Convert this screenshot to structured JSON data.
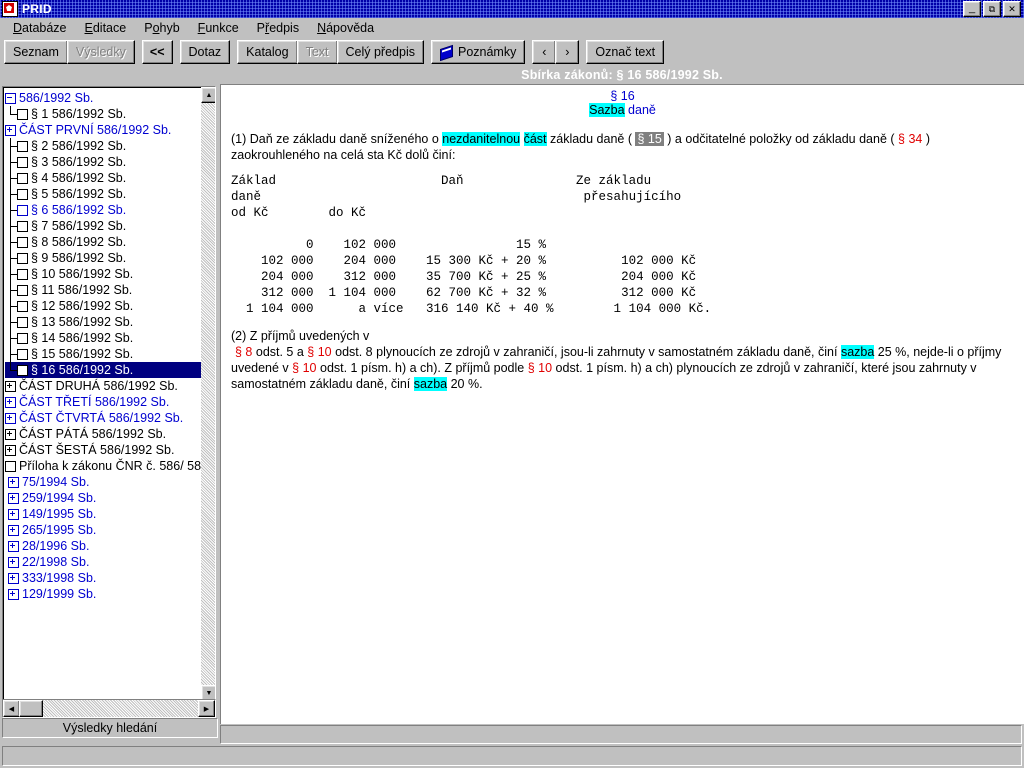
{
  "window": {
    "title": "PRID",
    "icon": "app-icon",
    "buttons": {
      "minimize": "_",
      "maximize": "❐",
      "close": "✕"
    }
  },
  "menu": [
    {
      "pre": "",
      "accel": "D",
      "post": "atabáze"
    },
    {
      "pre": "",
      "accel": "E",
      "post": "ditace"
    },
    {
      "pre": "P",
      "accel": "o",
      "post": "hyb"
    },
    {
      "pre": "",
      "accel": "F",
      "post": "unkce"
    },
    {
      "pre": "P",
      "accel": "ř",
      "post": "edpis"
    },
    {
      "pre": "",
      "accel": "N",
      "post": "ápověda"
    }
  ],
  "toolbar": {
    "groups": [
      {
        "buttons": [
          {
            "label": "Seznam",
            "disabled": false,
            "icon": null
          },
          {
            "label": "Výsledky",
            "disabled": true,
            "icon": null
          }
        ]
      },
      {
        "buttons": [
          {
            "label": "<<",
            "disabled": false,
            "icon": null
          }
        ]
      },
      {
        "buttons": [
          {
            "label": "Dotaz",
            "disabled": false,
            "icon": null
          }
        ]
      },
      {
        "buttons": [
          {
            "label": "Katalog",
            "disabled": false,
            "icon": null
          },
          {
            "label": "Text",
            "disabled": true,
            "icon": null
          },
          {
            "label": "Celý předpis",
            "disabled": false,
            "icon": null
          }
        ]
      },
      {
        "buttons": [
          {
            "label": "Poznámky",
            "disabled": false,
            "icon": "notebook-icon"
          }
        ]
      },
      {
        "buttons": [
          {
            "label": "‹",
            "disabled": false,
            "icon": null
          },
          {
            "label": "›",
            "disabled": false,
            "icon": null
          }
        ]
      },
      {
        "buttons": [
          {
            "label": "Označ text",
            "disabled": false,
            "icon": null
          }
        ]
      }
    ]
  },
  "header": {
    "caption": "Sbírka zákonů:   § 16 586/1992 Sb."
  },
  "tree": {
    "items": [
      {
        "depth": 0,
        "box": "minus",
        "boxColor": "blue",
        "label": "586/1992 Sb.",
        "color": "blue",
        "selected": false,
        "last": false
      },
      {
        "depth": 1,
        "box": "none",
        "boxColor": "black",
        "label": "§ 1 586/1992 Sb.",
        "color": "black",
        "selected": false,
        "last": true
      },
      {
        "depth": 0,
        "box": "plus",
        "boxColor": "blue",
        "label": "ČÁST PRVNÍ 586/1992 Sb.",
        "color": "blue",
        "selected": false,
        "last": false
      },
      {
        "depth": 1,
        "box": "none",
        "boxColor": "black",
        "label": "§ 2 586/1992 Sb.",
        "color": "black",
        "selected": false,
        "last": false
      },
      {
        "depth": 1,
        "box": "none",
        "boxColor": "black",
        "label": "§ 3 586/1992 Sb.",
        "color": "black",
        "selected": false,
        "last": false
      },
      {
        "depth": 1,
        "box": "none",
        "boxColor": "black",
        "label": "§ 4 586/1992 Sb.",
        "color": "black",
        "selected": false,
        "last": false
      },
      {
        "depth": 1,
        "box": "none",
        "boxColor": "black",
        "label": "§ 5 586/1992 Sb.",
        "color": "black",
        "selected": false,
        "last": false
      },
      {
        "depth": 1,
        "box": "none",
        "boxColor": "blue",
        "label": "§ 6 586/1992 Sb.",
        "color": "blue",
        "selected": false,
        "last": false
      },
      {
        "depth": 1,
        "box": "none",
        "boxColor": "black",
        "label": "§ 7 586/1992 Sb.",
        "color": "black",
        "selected": false,
        "last": false
      },
      {
        "depth": 1,
        "box": "none",
        "boxColor": "black",
        "label": "§ 8 586/1992 Sb.",
        "color": "black",
        "selected": false,
        "last": false
      },
      {
        "depth": 1,
        "box": "none",
        "boxColor": "black",
        "label": "§ 9 586/1992 Sb.",
        "color": "black",
        "selected": false,
        "last": false
      },
      {
        "depth": 1,
        "box": "none",
        "boxColor": "black",
        "label": "§ 10 586/1992 Sb.",
        "color": "black",
        "selected": false,
        "last": false
      },
      {
        "depth": 1,
        "box": "none",
        "boxColor": "black",
        "label": "§ 11 586/1992 Sb.",
        "color": "black",
        "selected": false,
        "last": false
      },
      {
        "depth": 1,
        "box": "none",
        "boxColor": "black",
        "label": "§ 12 586/1992 Sb.",
        "color": "black",
        "selected": false,
        "last": false
      },
      {
        "depth": 1,
        "box": "none",
        "boxColor": "black",
        "label": "§ 13 586/1992 Sb.",
        "color": "black",
        "selected": false,
        "last": false
      },
      {
        "depth": 1,
        "box": "none",
        "boxColor": "black",
        "label": "§ 14 586/1992 Sb.",
        "color": "black",
        "selected": false,
        "last": false
      },
      {
        "depth": 1,
        "box": "none",
        "boxColor": "black",
        "label": "§ 15 586/1992 Sb.",
        "color": "black",
        "selected": false,
        "last": false
      },
      {
        "depth": 1,
        "box": "none",
        "boxColor": "black",
        "label": "§ 16 586/1992 Sb.",
        "color": "black",
        "selected": true,
        "last": true
      },
      {
        "depth": 0,
        "box": "plus",
        "boxColor": "black",
        "label": "ČÁST DRUHÁ 586/1992 Sb.",
        "color": "black",
        "selected": false,
        "last": false
      },
      {
        "depth": 0,
        "box": "plus",
        "boxColor": "blue",
        "label": "ČÁST TŘETÍ 586/1992 Sb.",
        "color": "blue",
        "selected": false,
        "last": false
      },
      {
        "depth": 0,
        "box": "plus",
        "boxColor": "blue",
        "label": "ČÁST ČTVRTÁ 586/1992 Sb.",
        "color": "blue",
        "selected": false,
        "last": false
      },
      {
        "depth": 0,
        "box": "plus",
        "boxColor": "black",
        "label": "ČÁST PÁTÁ 586/1992 Sb.",
        "color": "black",
        "selected": false,
        "last": false
      },
      {
        "depth": 0,
        "box": "plus",
        "boxColor": "black",
        "label": "ČÁST ŠESTÁ 586/1992 Sb.",
        "color": "black",
        "selected": false,
        "last": false
      },
      {
        "depth": 0,
        "box": "none",
        "boxColor": "black",
        "label": "Příloha k zákonu ČNR č. 586/ 58",
        "color": "black",
        "selected": false,
        "last": true
      },
      {
        "depth": -1,
        "box": "plus",
        "boxColor": "blue",
        "label": "75/1994 Sb.",
        "color": "blue",
        "selected": false,
        "last": false
      },
      {
        "depth": -1,
        "box": "plus",
        "boxColor": "blue",
        "label": "259/1994 Sb.",
        "color": "blue",
        "selected": false,
        "last": false
      },
      {
        "depth": -1,
        "box": "plus",
        "boxColor": "blue",
        "label": "149/1995 Sb.",
        "color": "blue",
        "selected": false,
        "last": false
      },
      {
        "depth": -1,
        "box": "plus",
        "boxColor": "blue",
        "label": "265/1995 Sb.",
        "color": "blue",
        "selected": false,
        "last": false
      },
      {
        "depth": -1,
        "box": "plus",
        "boxColor": "blue",
        "label": "28/1996 Sb.",
        "color": "blue",
        "selected": false,
        "last": false
      },
      {
        "depth": -1,
        "box": "plus",
        "boxColor": "blue",
        "label": "22/1998 Sb.",
        "color": "blue",
        "selected": false,
        "last": false
      },
      {
        "depth": -1,
        "box": "plus",
        "boxColor": "blue",
        "label": "333/1998 Sb.",
        "color": "blue",
        "selected": false,
        "last": false
      },
      {
        "depth": -1,
        "box": "plus",
        "boxColor": "blue",
        "label": "129/1999 Sb.",
        "color": "blue",
        "selected": false,
        "last": false
      }
    ],
    "status": "Výsledky hledání"
  },
  "document": {
    "section_number": "§ 16",
    "section_title_hl": "Sazba",
    "section_title_rest": " daně",
    "para1": {
      "t1": "(1) Daň ze základu daně sníženého o ",
      "hl1": "nezdanitelnou",
      "t2": " ",
      "hl2": "část",
      "t3": " základu daně ( ",
      "lnk_sel": "§ 15",
      "t4": " ) a odčitatelné položky od základu daně ( ",
      "lnk_red": "§ 34",
      "t5": " )",
      "t6": "zaokrouhleného na celá sta Kč dolů činí:"
    },
    "rate_table": "Základ                      Daň               Ze základu\ndaně                                           přesahujícího\nod Kč        do Kč\n\n          0    102 000                15 %\n    102 000    204 000    15 300 Kč + 20 %          102 000 Kč\n    204 000    312 000    35 700 Kč + 25 %          204 000 Kč\n    312 000  1 104 000    62 700 Kč + 32 %          312 000 Kč\n  1 104 000      a více   316 140 Kč + 40 %        1 104 000 Kč.",
    "para2": {
      "t1": "(2) Z příjmů uvedených v",
      "l1": "§ 8",
      "t2": " odst. 5 a ",
      "l2": "§ 10",
      "t3": " odst. 8 plynoucích ze zdrojů v zahraničí, jsou-li zahrnuty v samostatném základu daně, činí ",
      "hl1": "sazba",
      "t4": " 25 %, nejde-li o příjmy uvedené v ",
      "l3": "§ 10",
      "t5": " odst. 1 písm. h) a ch). Z příjmů podle ",
      "l4": "§ 10",
      "t6": " odst. 1 písm. h) a ch) plynoucích ze zdrojů v zahraničí, které jsou zahrnuty v samostatném základu daně, činí ",
      "hl2": "sazba",
      "t7": " 20 %."
    }
  },
  "colors": {
    "face": "#c0c0c0",
    "titlebar": "#0000a8",
    "link_red": "#e00000",
    "link_blue": "#0000d0",
    "highlight": "#00ffff",
    "selection": "#000080"
  }
}
